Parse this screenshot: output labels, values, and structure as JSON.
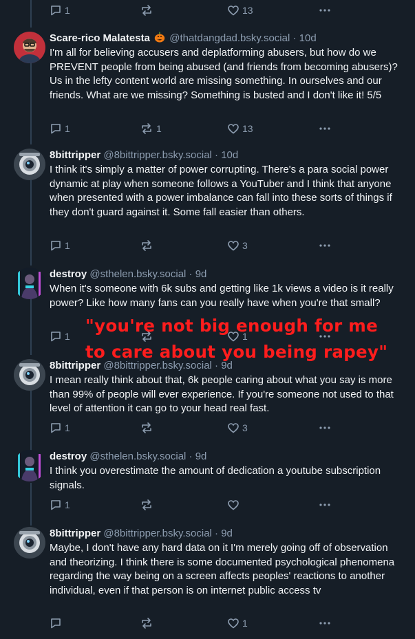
{
  "top_actions": {
    "reply_count": "1",
    "repost_count": "",
    "like_count": "13"
  },
  "posts": [
    {
      "author": "Scare-rico Malatesta",
      "handle": "@thatdangdad.bsky.social",
      "time": "10d",
      "text": "I'm all for believing accusers and deplatforming abusers, but how do we PREVENT people from being abused (and friends from becoming abusers)? Us in the lefty content world are missing something. In ourselves and our friends. What are we missing? Something is busted and I don't like it! 5/5",
      "reply_count": "1",
      "repost_count": "1",
      "like_count": "13"
    },
    {
      "author": "8bittripper",
      "handle": "@8bittripper.bsky.social",
      "time": "10d",
      "text": "I think it's simply a matter of power corrupting. There's a para social power dynamic at play when someone follows a YouTuber and I think that anyone when presented with a power imbalance can fall into these sorts of things if they don't guard against it. Some fall easier than others.",
      "reply_count": "1",
      "repost_count": "",
      "like_count": "3"
    },
    {
      "author": "destroy",
      "handle": "@sthelen.bsky.social",
      "time": "9d",
      "text": "When it's someone with 6k subs and getting like 1k views a video is it really power? Like how many fans can you really have when you're that small?",
      "reply_count": "1",
      "repost_count": "",
      "like_count": "1"
    },
    {
      "author": "8bittripper",
      "handle": "@8bittripper.bsky.social",
      "time": "9d",
      "text": "I mean really think about that, 6k people caring about what you say is more than 99% of people will ever experience. If you're someone not used to that level of attention it can go to your head real fast.",
      "reply_count": "1",
      "repost_count": "",
      "like_count": "3"
    },
    {
      "author": "destroy",
      "handle": "@sthelen.bsky.social",
      "time": "9d",
      "text": "I think you overestimate the amount of dedication a youtube subscription signals.",
      "reply_count": "1",
      "repost_count": "",
      "like_count": ""
    },
    {
      "author": "8bittripper",
      "handle": "@8bittripper.bsky.social",
      "time": "9d",
      "text": "Maybe, I don't have any hard data on it I'm merely going off of observation and theorizing. I think there is some documented psychological phenomena regarding the way being on a screen affects peoples' reactions to another individual, even if that person is on internet public access tv",
      "reply_count": "",
      "repost_count": "",
      "like_count": "1"
    }
  ],
  "overlay": {
    "line1": "\"you're not big enough for me",
    "line2": "to care about you being rapey\""
  },
  "separator": "·",
  "colors": {
    "background": "#161e27",
    "muted": "#8d9db0",
    "overlay": "#ff1d1d",
    "thread_line": "#2e4052"
  }
}
